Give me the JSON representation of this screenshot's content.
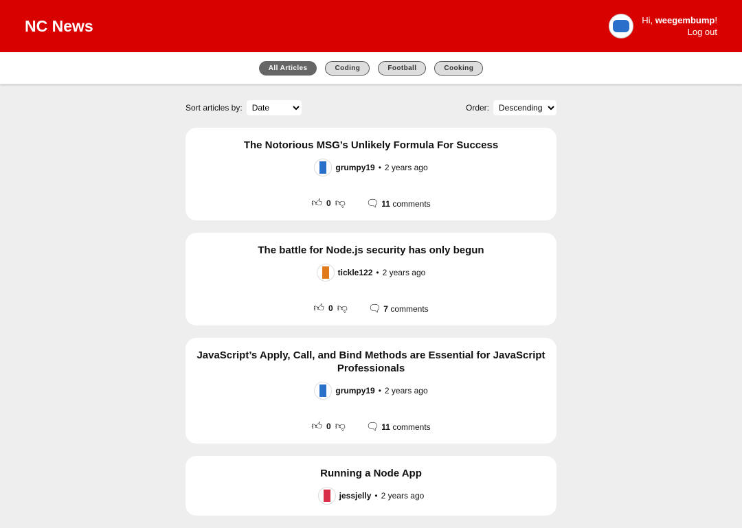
{
  "header": {
    "logo": "NC News",
    "greeting": "Hi, ",
    "username": "weegembump",
    "excl": "!",
    "logout": "Log out"
  },
  "nav": {
    "topics": [
      "All Articles",
      "Coding",
      "Football",
      "Cooking"
    ]
  },
  "controls": {
    "sort_label": "Sort articles by:",
    "sort_value": "Date",
    "order_label": "Order:",
    "order_value": "Descending"
  },
  "articles": [
    {
      "title": "The Notorious MSG’s Unlikely Formula For Success",
      "author": "grumpy19",
      "age": "2 years ago",
      "votes": "0",
      "comments": "11",
      "comments_label": "comments",
      "color": "#2a6fc9"
    },
    {
      "title": "The battle for Node.js security has only begun",
      "author": "tickle122",
      "age": "2 years ago",
      "votes": "0",
      "comments": "7",
      "comments_label": "comments",
      "color": "#e07a1a"
    },
    {
      "title": "JavaScript’s Apply, Call, and Bind Methods are Essential for JavaScript Professionals",
      "author": "grumpy19",
      "age": "2 years ago",
      "votes": "0",
      "comments": "11",
      "comments_label": "comments",
      "color": "#2a6fc9"
    },
    {
      "title": "Running a Node App",
      "author": "jessjelly",
      "age": "2 years ago",
      "votes": "",
      "comments": "",
      "comments_label": "",
      "color": "#d9304a"
    }
  ]
}
